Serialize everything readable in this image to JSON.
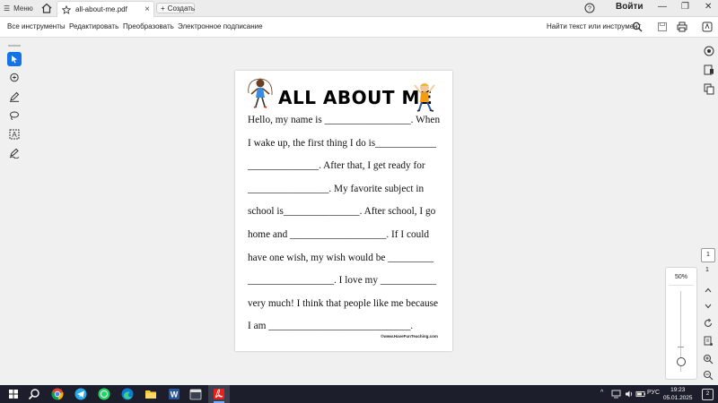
{
  "tabbar": {
    "menu_label": "Меню",
    "tab_title": "all-about-me.pdf",
    "new_tab_label": "Создать",
    "signin_label": "Войти"
  },
  "toolbar": {
    "all_tools": "Все инструменты",
    "edit": "Редактировать",
    "convert": "Преобразовать",
    "esign": "Электронное подписание",
    "find": "Найти текст или инструмент"
  },
  "document": {
    "title": "ALL ABOUT ME",
    "lines": [
      "Hello, my name is _________________. When",
      "I wake up, the first thing I do is____________",
      "______________. After that, I get ready for",
      "________________. My favorite subject in",
      "school is_______________. After school, I go",
      "home and ___________________. If I could",
      "have one wish, my wish would be _________",
      "_________________. I love my ___________",
      "very much! I think that people like me because",
      "I am ____________________________."
    ],
    "credit": "©www.HaveFunTeaching.com"
  },
  "zoom": {
    "percent": "50%",
    "level": 0.5
  },
  "pagination": {
    "current": "1",
    "total": "1"
  },
  "taskbar": {
    "lang": "РУС",
    "time": "19:23",
    "date": "05.01.2025",
    "notif_count": "2"
  },
  "colors": {
    "accent": "#1473e6",
    "taskbar": "#1c1f2b",
    "acrobat": "#e8211c"
  }
}
